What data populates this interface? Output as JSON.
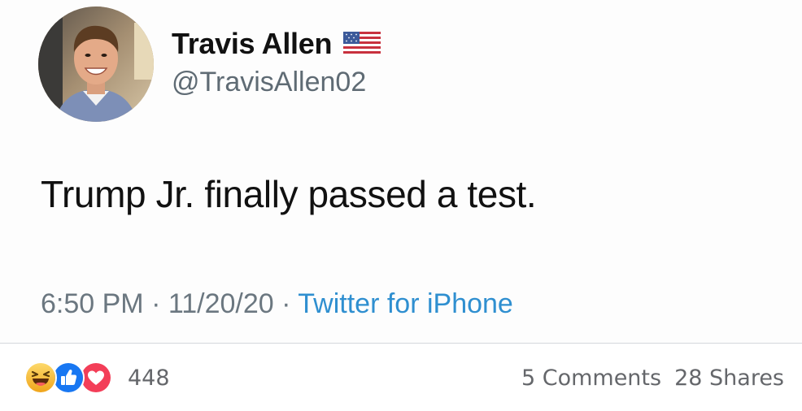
{
  "tweet": {
    "display_name": "Travis Allen",
    "handle": "@TravisAllen02",
    "text": "Trump Jr. finally passed a test.",
    "time": "6:50 PM",
    "date": "11/20/20",
    "source": "Twitter for iPhone",
    "separator": " · ",
    "name_badge_icon": "us-flag-icon"
  },
  "reactions": {
    "icons": [
      "haha-reaction-icon",
      "like-reaction-icon",
      "love-reaction-icon"
    ],
    "count": "448"
  },
  "engagement": {
    "comments": "5 Comments",
    "shares": "28 Shares"
  },
  "colors": {
    "link_blue": "#2f8fd0",
    "like_blue": "#1877f2",
    "love_red": "#f33e58",
    "haha_yellow": "#f7b125",
    "meta_grey": "#6b7780"
  }
}
